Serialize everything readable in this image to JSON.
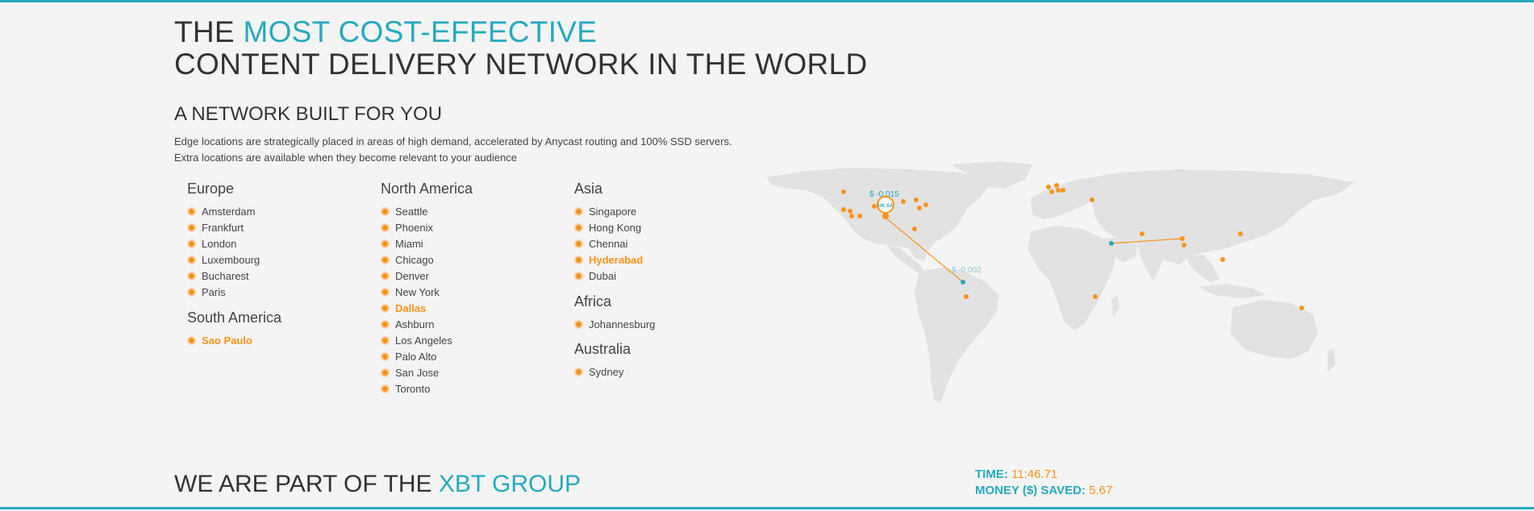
{
  "hero": {
    "title_prefix": "THE ",
    "title_accent": "MOST COST-EFFECTIVE",
    "title_line2": "CONTENT DELIVERY NETWORK IN THE WORLD"
  },
  "network": {
    "title": "A NETWORK BUILT FOR YOU",
    "description_line1": "Edge locations are strategically placed in areas of high demand, accelerated by Anycast routing and 100% SSD servers.",
    "description_line2": "Extra locations are available when they become relevant to your audience"
  },
  "regions": {
    "europe": {
      "name": "Europe",
      "cities": [
        {
          "name": "Amsterdam",
          "highlight": false
        },
        {
          "name": "Frankfurt",
          "highlight": false
        },
        {
          "name": "London",
          "highlight": false
        },
        {
          "name": "Luxembourg",
          "highlight": false
        },
        {
          "name": "Bucharest",
          "highlight": false
        },
        {
          "name": "Paris",
          "highlight": false
        }
      ]
    },
    "south_america": {
      "name": "South America",
      "cities": [
        {
          "name": "Sao Paulo",
          "highlight": true
        }
      ]
    },
    "north_america": {
      "name": "North America",
      "cities": [
        {
          "name": "Seattle",
          "highlight": false
        },
        {
          "name": "Phoenix",
          "highlight": false
        },
        {
          "name": "Miami",
          "highlight": false
        },
        {
          "name": "Chicago",
          "highlight": false
        },
        {
          "name": "Denver",
          "highlight": false
        },
        {
          "name": "New York",
          "highlight": false
        },
        {
          "name": "Dallas",
          "highlight": true
        },
        {
          "name": "Ashburn",
          "highlight": false
        },
        {
          "name": "Los Angeles",
          "highlight": false
        },
        {
          "name": "Palo Alto",
          "highlight": false
        },
        {
          "name": "San Jose",
          "highlight": false
        },
        {
          "name": "Toronto",
          "highlight": false
        }
      ]
    },
    "asia": {
      "name": "Asia",
      "cities": [
        {
          "name": "Singapore",
          "highlight": false
        },
        {
          "name": "Hong Kong",
          "highlight": false
        },
        {
          "name": "Chennai",
          "highlight": false
        },
        {
          "name": "Hyderabad",
          "highlight": true
        },
        {
          "name": "Dubai",
          "highlight": false
        }
      ]
    },
    "africa": {
      "name": "Africa",
      "cities": [
        {
          "name": "Johannesburg",
          "highlight": false
        }
      ]
    },
    "australia": {
      "name": "Australia",
      "cities": [
        {
          "name": "Sydney",
          "highlight": false
        }
      ]
    }
  },
  "map": {
    "price_label_1": "$ -0.015",
    "price_label_2": "$ -0.002",
    "badge_text": "UK SA",
    "colors": {
      "land": "#e2e2e2",
      "node": "#f7941d",
      "accent": "#27aabd"
    }
  },
  "stats": {
    "time_label": "TIME: ",
    "time_value": "11:46.71",
    "money_label": "MONEY ($) SAVED: ",
    "money_value": "5.67"
  },
  "footer": {
    "title_prefix": "WE ARE PART OF THE ",
    "title_accent": "XBT GROUP"
  },
  "colors": {
    "accent": "#27aabd",
    "orange": "#f7941d",
    "background": "#f4f4f4"
  }
}
